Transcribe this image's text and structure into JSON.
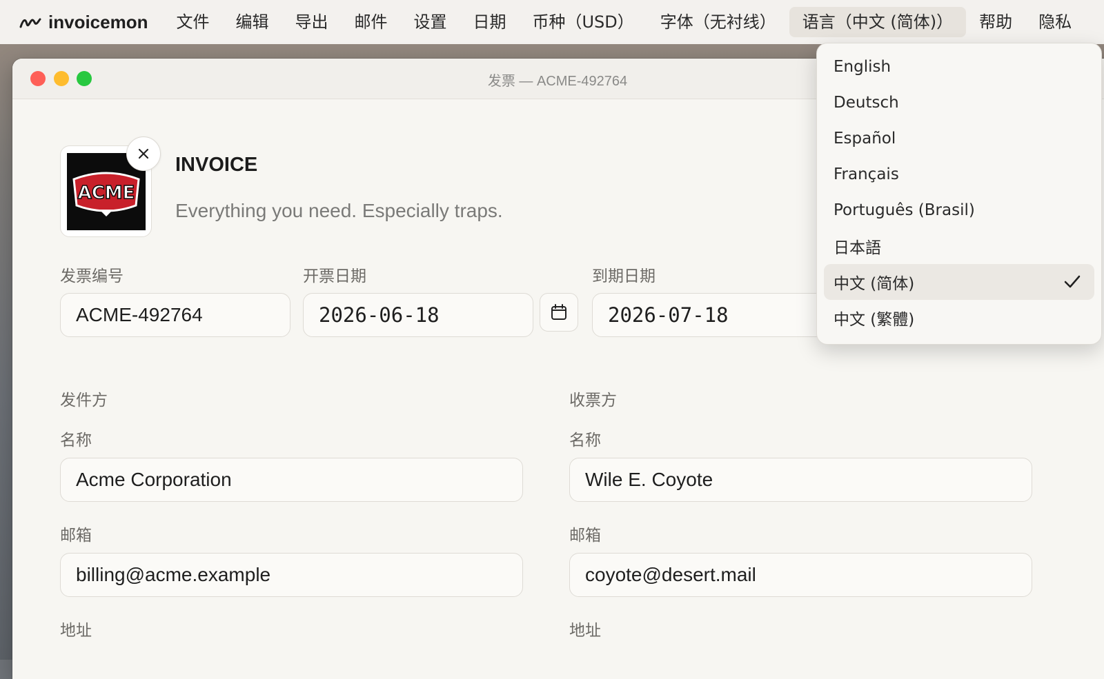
{
  "menubar": {
    "app_name": "invoicemon",
    "items": [
      "文件",
      "编辑",
      "导出",
      "邮件",
      "设置",
      "日期",
      "币种（USD）",
      "字体（无衬线）",
      "语言（中文 (简体)）",
      "帮助",
      "隐私"
    ]
  },
  "window": {
    "title": "发票 — ACME-492764"
  },
  "header": {
    "doc_title": "INVOICE",
    "tagline": "Everything you need. Especially traps.",
    "logo_text": "ACME"
  },
  "meta": {
    "invoice_number_label": "发票编号",
    "invoice_number": "ACME-492764",
    "issue_date_label": "开票日期",
    "issue_date": "2026-06-18",
    "due_date_label": "到期日期",
    "due_date": "2026-07-18"
  },
  "sender": {
    "section_label": "发件方",
    "name_label": "名称",
    "name": "Acme Corporation",
    "email_label": "邮箱",
    "email": "billing@acme.example",
    "address_label": "地址"
  },
  "recipient": {
    "section_label": "收票方",
    "name_label": "名称",
    "name": "Wile E. Coyote",
    "email_label": "邮箱",
    "email": "coyote@desert.mail",
    "address_label": "地址"
  },
  "language_menu": {
    "options": [
      "English",
      "Deutsch",
      "Español",
      "Français",
      "Português (Brasil)",
      "日本語",
      "中文 (简体)",
      "中文 (繁體)"
    ],
    "selected": "中文 (简体)"
  },
  "colors": {
    "accent_selected": "#ebe8e3",
    "traffic_red": "#fe5f57",
    "traffic_yellow": "#febc2e",
    "traffic_green": "#28c840"
  }
}
